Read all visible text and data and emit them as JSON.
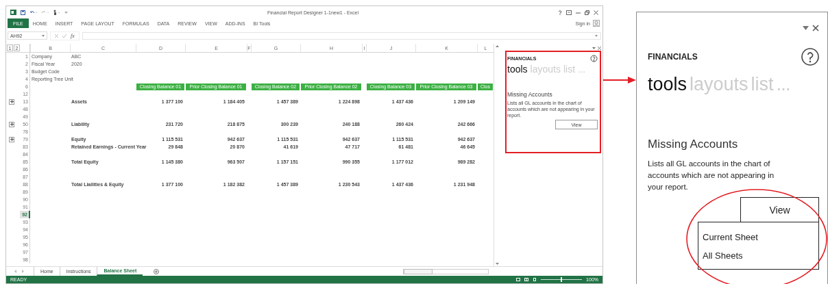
{
  "excel": {
    "title": "Financial Report Designer 1-1new1 - Excel",
    "sign_in": "Sign in",
    "ribbon_tabs": [
      {
        "label": "FILE",
        "kind": "file"
      },
      {
        "label": "HOME",
        "kind": "tab"
      },
      {
        "label": "INSERT",
        "kind": "tab"
      },
      {
        "label": "PAGE LAYOUT",
        "kind": "tab"
      },
      {
        "label": "FORMULAS",
        "kind": "tab"
      },
      {
        "label": "DATA",
        "kind": "tab"
      },
      {
        "label": "REVIEW",
        "kind": "tab"
      },
      {
        "label": "VIEW",
        "kind": "tab"
      },
      {
        "label": "ADD-INS",
        "kind": "tab"
      },
      {
        "label": "BI Tools",
        "kind": "tab"
      }
    ],
    "name_box": "AH92",
    "function_label": "fx",
    "outline_levels": [
      "1",
      "2"
    ],
    "columns": [
      "B",
      "C",
      "D",
      "E",
      "F",
      "G",
      "H",
      "I",
      "J",
      "K",
      "L"
    ],
    "rows": [
      {
        "number": "1",
        "kind": "info",
        "label": "Company",
        "value": "ABC",
        "selected": false
      },
      {
        "number": "2",
        "kind": "info",
        "label": "Fiscal Year",
        "value": "2020",
        "selected": false
      },
      {
        "number": "3",
        "kind": "info",
        "label": "Budget Code",
        "selected": false
      },
      {
        "number": "4",
        "kind": "info",
        "label": "Reporting Tree Unit",
        "selected": false
      },
      {
        "number": "6",
        "kind": "headers",
        "headers": [
          "Closing Balance 01",
          "Prior Closing Balance 01",
          "Closing Balance 02",
          "Prior Closing Balance 02",
          "Closing Balance 03",
          "Prior Closing Balance 03",
          "Clos"
        ],
        "selected": false
      },
      {
        "number": "12",
        "kind": "blank",
        "selected": false
      },
      {
        "number": "13",
        "kind": "data",
        "expander": true,
        "label": "Assets",
        "values": [
          "1 377 100",
          "1 184 405",
          "1 457 389",
          "1 224 898",
          "1 437 436",
          "1 209 149"
        ],
        "selected": false
      },
      {
        "number": "48",
        "kind": "blank",
        "selected": false
      },
      {
        "number": "49",
        "kind": "blank",
        "selected": false
      },
      {
        "number": "50",
        "kind": "data",
        "expander": true,
        "label": "Liability",
        "values": [
          "231 720",
          "218 875",
          "300 239",
          "240 188",
          "260 424",
          "242 666"
        ],
        "selected": false
      },
      {
        "number": "78",
        "kind": "blank",
        "selected": false
      },
      {
        "number": "79",
        "kind": "data",
        "expander": true,
        "label": "Equity",
        "values": [
          "1 115 531",
          "942 637",
          "1 115 531",
          "942 637",
          "1 115 531",
          "942 637"
        ],
        "selected": false
      },
      {
        "number": "83",
        "kind": "data",
        "label": "Retained Earnings - Current Year",
        "values": [
          "29 848",
          "20 870",
          "41 619",
          "47 717",
          "61 481",
          "46 645"
        ],
        "selected": false
      },
      {
        "number": "84",
        "kind": "blank",
        "selected": false
      },
      {
        "number": "85",
        "kind": "data",
        "label": "Total Equity",
        "values": [
          "1 145 380",
          "963 507",
          "1 157 151",
          "990 355",
          "1 177 012",
          "989 282"
        ],
        "selected": false
      },
      {
        "number": "86",
        "kind": "blank",
        "selected": false
      },
      {
        "number": "87",
        "kind": "blank",
        "selected": false
      },
      {
        "number": "88",
        "kind": "data",
        "label": "Total Liailities & Equity",
        "values": [
          "1 377 100",
          "1 182 382",
          "1 457 389",
          "1 230 543",
          "1 437 436",
          "1 231 948"
        ],
        "selected": false
      },
      {
        "number": "89",
        "kind": "blank",
        "selected": false
      },
      {
        "number": "90",
        "kind": "blank",
        "selected": false
      },
      {
        "number": "91",
        "kind": "blank",
        "selected": false
      },
      {
        "number": "92",
        "kind": "blank",
        "selected": true
      },
      {
        "number": "93",
        "kind": "blank",
        "selected": false
      },
      {
        "number": "94",
        "kind": "blank",
        "selected": false
      },
      {
        "number": "95",
        "kind": "blank",
        "selected": false
      },
      {
        "number": "96",
        "kind": "blank",
        "selected": false
      },
      {
        "number": "97",
        "kind": "blank",
        "selected": false
      },
      {
        "number": "98",
        "kind": "blank",
        "selected": false
      }
    ],
    "sheet_tabs": [
      {
        "label": "Home",
        "selected": false
      },
      {
        "label": "Instructions",
        "selected": false
      },
      {
        "label": "Balance Sheet",
        "selected": true
      }
    ],
    "status": "READY",
    "zoom": {
      "level": 0.5,
      "reading": "100%"
    },
    "task_pane": {
      "title": "FINANCIALS",
      "nav": [
        {
          "label": "tools",
          "selected": true
        },
        {
          "label": "layouts",
          "selected": false
        },
        {
          "label": "list",
          "selected": false
        }
      ],
      "more": "...",
      "card_title": "Missing Accounts",
      "description": "Lists all GL accounts in the chart of accounts which are not appearing in your report.",
      "button": "View"
    }
  },
  "callout": {
    "title": "FINANCIALS",
    "nav": [
      {
        "label": "tools",
        "selected": true
      },
      {
        "label": "layouts",
        "selected": false
      },
      {
        "label": "list",
        "selected": false
      }
    ],
    "more": "...",
    "card_title": "Missing Accounts",
    "description": "Lists all GL accounts in the chart of accounts which are not appearing in your report.",
    "button": "View",
    "menu": [
      {
        "label": "Current Sheet"
      },
      {
        "label": "All Sheets"
      }
    ]
  }
}
